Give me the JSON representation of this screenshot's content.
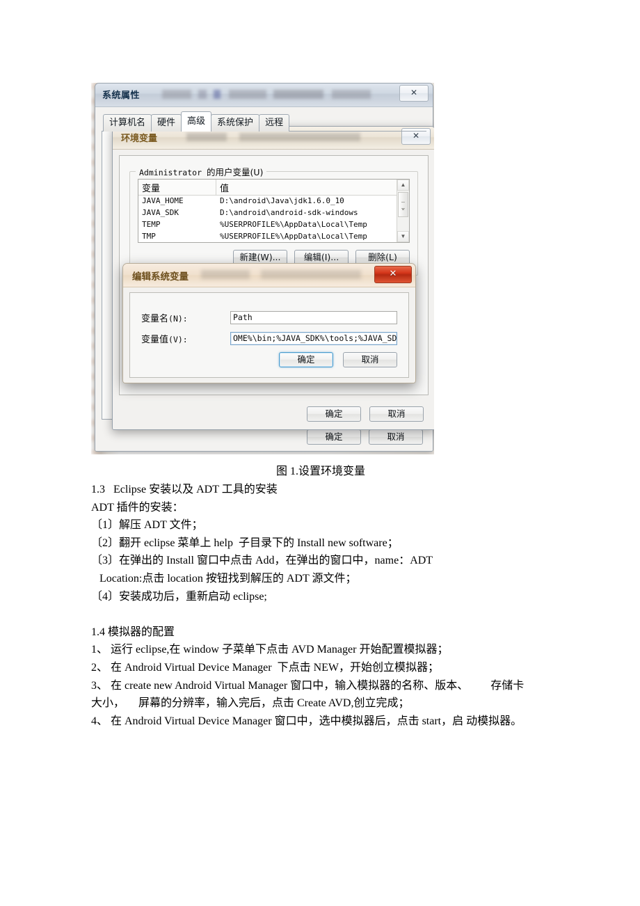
{
  "figure": {
    "system_properties": {
      "window_title": "系统属性",
      "close_label": "✕",
      "tabs": [
        {
          "label": "计算机名",
          "active": false
        },
        {
          "label": "硬件",
          "active": false
        },
        {
          "label": "高级",
          "active": true
        },
        {
          "label": "系统保护",
          "active": false
        },
        {
          "label": "远程",
          "active": false
        }
      ],
      "footer_buttons": [
        {
          "label": "确定"
        },
        {
          "label": "取消"
        }
      ]
    },
    "environment_variables": {
      "window_title": "环境变量",
      "close_label": "✕",
      "group_legend_mono": "Administrator",
      "group_legend_cjk": "的用户变量(U)",
      "table": {
        "headers": [
          "变量",
          "值"
        ],
        "rows": [
          [
            "JAVA_HOME",
            "D:\\android\\Java\\jdk1.6.0_10"
          ],
          [
            "JAVA_SDK",
            "D:\\android\\android-sdk-windows"
          ],
          [
            "TEMP",
            "%USERPROFILE%\\AppData\\Local\\Temp"
          ],
          [
            "TMP",
            "%USERPROFILE%\\AppData\\Local\\Temp"
          ]
        ]
      },
      "scrollbar": {
        "up_glyph": "▲",
        "down_glyph": "▼"
      },
      "group_buttons": [
        {
          "label": "新建(W)..."
        },
        {
          "label": "编辑(I)..."
        },
        {
          "label": "删除(L)"
        }
      ],
      "footer_buttons": [
        {
          "label": "确定"
        },
        {
          "label": "取消"
        }
      ]
    },
    "edit_system_variable": {
      "window_title": "编辑系统变量",
      "close_label": "✕",
      "fields": [
        {
          "label_cjk": "变量名",
          "label_paren": "(N):",
          "value": "Path",
          "focused": false
        },
        {
          "label_cjk": "变量值",
          "label_paren": "(V):",
          "value": "OME%\\bin;%JAVA_SDK%\\tools;%JAVA_SDK%",
          "focused": true
        }
      ],
      "buttons": [
        {
          "label": "确定",
          "default": true
        },
        {
          "label": "取消",
          "default": false
        }
      ]
    },
    "colors": {
      "close_red": "#d4361a",
      "focus_blue": "#4b9ccd",
      "envvars_title_text": "#7a5a20",
      "sysprops_title_text": "#16324d"
    }
  },
  "document": {
    "figure_caption": "图 1.设置环境变量",
    "paragraphs": [
      "1.3   Eclipse 安装以及 ADT 工具的安装",
      "ADT 插件的安装：",
      "〔1〕解压 ADT 文件；",
      "〔2〕翻开 eclipse 菜单上 help  子目录下的 Install new software；",
      "〔3〕在弹出的 Install 窗口中点击 Add，在弹出的窗口中，name：ADT",
      "   Location:点击 location 按钮找到解压的 ADT 源文件；",
      "〔4〕安装成功后，重新启动 eclipse;",
      "",
      "1.4 模拟器的配置",
      "1、 运行 eclipse,在 window 子菜单下点击 AVD Manager 开始配置模拟器；",
      "2、 在 Android Virtual Device Manager  下点击 NEW，开始创立模拟器；",
      "3、 在 create new Android Virtual Manager 窗口中，输入模拟器的名称、版本、        存储卡",
      "大小，     屏幕的分辨率，输入完后，点击 Create AVD,创立完成；",
      "4、 在 Android Virtual Device Manager 窗口中，选中模拟器后，点击 start，启 动模拟器。"
    ]
  }
}
